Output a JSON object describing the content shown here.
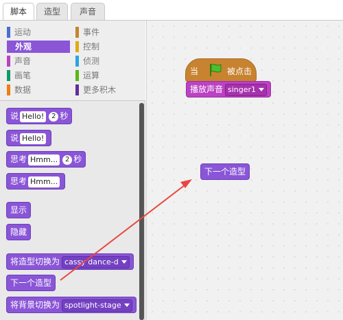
{
  "tabs": [
    {
      "label": "脚本",
      "active": true
    },
    {
      "label": "造型",
      "active": false
    },
    {
      "label": "声音",
      "active": false
    }
  ],
  "categories": [
    {
      "label": "运动",
      "color": "#4a6cd4"
    },
    {
      "label": "事件",
      "color": "#c88330"
    },
    {
      "label": "外观",
      "color": "#8a55d7",
      "selected": true
    },
    {
      "label": "控制",
      "color": "#e1a91a"
    },
    {
      "label": "声音",
      "color": "#bb42c3"
    },
    {
      "label": "侦测",
      "color": "#2ca5e2"
    },
    {
      "label": "画笔",
      "color": "#0e9a6c"
    },
    {
      "label": "运算",
      "color": "#5cb712"
    },
    {
      "label": "数据",
      "color": "#ee7d16"
    },
    {
      "label": "更多积木",
      "color": "#632d99"
    }
  ],
  "palette_blocks": {
    "say_for_secs": {
      "label": "说",
      "text": "Hello!",
      "secs": "2",
      "unit": "秒"
    },
    "say": {
      "label": "说",
      "text": "Hello!"
    },
    "think_for_secs": {
      "label": "思考",
      "text": "Hmm...",
      "secs": "2",
      "unit": "秒"
    },
    "think": {
      "label": "思考",
      "text": "Hmm..."
    },
    "show": {
      "label": "显示"
    },
    "hide": {
      "label": "隐藏"
    },
    "switch_costume": {
      "label": "将造型切换为",
      "value": "cassy dance-d"
    },
    "next_costume": {
      "label": "下一个造型"
    },
    "switch_backdrop": {
      "label": "将背景切换为",
      "value": "spotlight-stage"
    }
  },
  "script": {
    "hat": {
      "label_before": "当",
      "label_after": "被点击",
      "flag_icon": "green-flag-icon"
    },
    "play_sound": {
      "label": "播放声音",
      "value": "singer1"
    },
    "next_costume": {
      "label": "下一个造型"
    }
  },
  "annotation": {
    "arrow_color": "#e8463f"
  },
  "colors": {
    "looks": "#8a55d7",
    "sound": "#bb42c3",
    "events": "#c88330"
  }
}
